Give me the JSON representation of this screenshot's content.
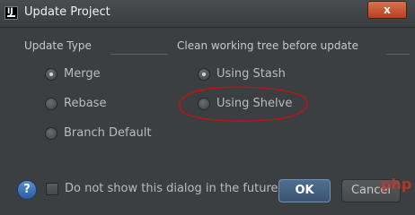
{
  "window": {
    "title": "Update Project",
    "app_icon_text": "IJ",
    "close_glyph": "x"
  },
  "update_type": {
    "title": "Update Type",
    "options": [
      {
        "label": "Merge",
        "checked": true
      },
      {
        "label": "Rebase",
        "checked": false
      },
      {
        "label": "Branch Default",
        "checked": false
      }
    ]
  },
  "clean_tree": {
    "title": "Clean working tree before update",
    "options": [
      {
        "label": "Using Stash",
        "checked": true
      },
      {
        "label": "Using Shelve",
        "checked": false
      }
    ]
  },
  "footer": {
    "help_glyph": "?",
    "dont_show_label": "Do not show this dialog in the future",
    "ok_label": "OK",
    "cancel_label": "Cancel"
  },
  "annotation": {
    "color": "#b01818"
  },
  "watermark": {
    "text": "php"
  }
}
